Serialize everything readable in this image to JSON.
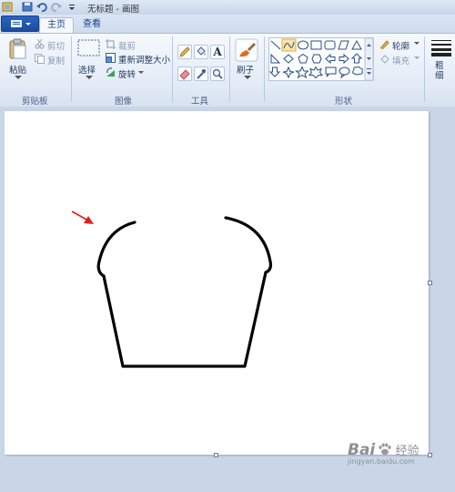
{
  "window": {
    "title": "无标题 - 画图"
  },
  "tabs": [
    {
      "label": "主页",
      "active": true
    },
    {
      "label": "查看",
      "active": false
    }
  ],
  "ribbon": {
    "clipboard": {
      "paste_label": "粘贴",
      "cut_label": "剪切",
      "copy_label": "复制",
      "group_label": "剪贴板"
    },
    "image": {
      "select_label": "选择",
      "crop_label": "裁剪",
      "resize_label": "重新调整大小",
      "rotate_label": "旋转",
      "group_label": "图像"
    },
    "tools": {
      "group_label": "工具",
      "text_tool_glyph": "A"
    },
    "brushes": {
      "label": "刷子"
    },
    "shapes": {
      "group_label": "形状",
      "outline_label": "轮廓",
      "fill_label": "填充"
    },
    "size": {
      "label": "粗细"
    }
  },
  "watermark": {
    "main": "Bai",
    "sub": "经验",
    "url": "jingyan.baidu.com"
  },
  "colors": {
    "accent": "#1b4c9e",
    "annotation_arrow": "#e02020",
    "canvas": "#ffffff",
    "workspace": "#c9d6e8"
  }
}
